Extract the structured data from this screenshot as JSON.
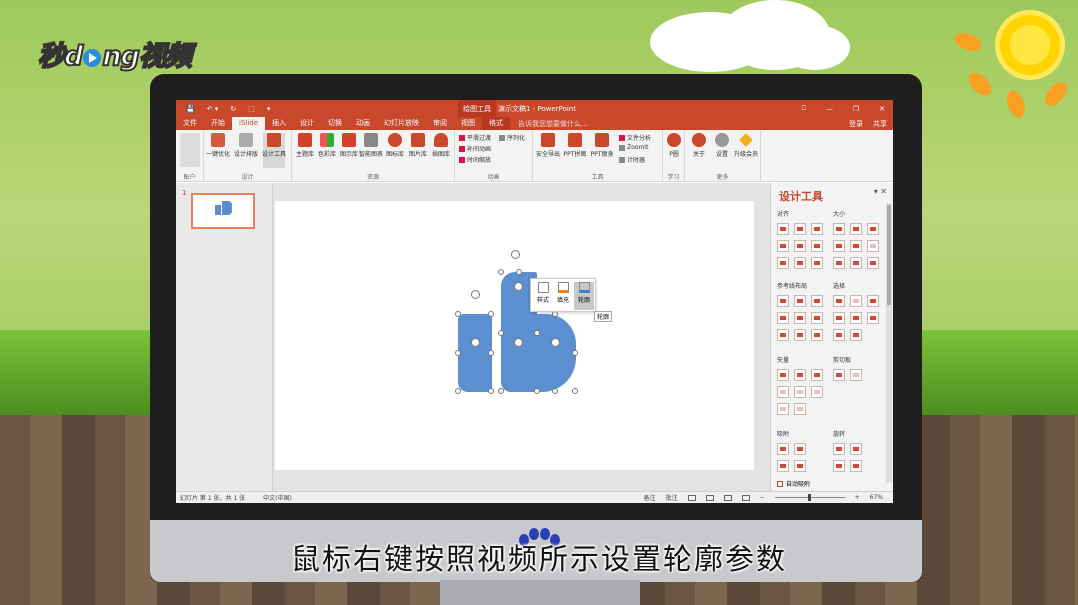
{
  "brand": {
    "text_before": "秒d",
    "text_after": "ng视频"
  },
  "window": {
    "quick_access": [
      "💾",
      "↶ ▾",
      "↻",
      "⬚",
      "▾"
    ],
    "context_group": "绘图工具",
    "doc_title": "演示文稿1 - PowerPoint",
    "controls": [
      "⎕",
      "—",
      "❐",
      "✕"
    ]
  },
  "tabs": {
    "items": [
      "文件",
      "开始",
      "iSlide",
      "插入",
      "设计",
      "切换",
      "动画",
      "幻灯片放映",
      "审阅",
      "视图",
      "格式"
    ],
    "tell_me": "告诉我您想要做什么...",
    "login": "登录",
    "share": "共享"
  },
  "ribbon": {
    "groups": [
      "账户",
      "设计",
      "资源",
      "动画",
      "工具",
      "学习",
      "更多"
    ],
    "buttons": [
      "一键优化",
      "设计排版",
      "设计工具",
      "主题库",
      "色彩库",
      "图示库",
      "智能图表",
      "图标库",
      "图片库",
      "插图库",
      "安全导出",
      "PPT拼图",
      "PPT瘦身",
      "P圈",
      "关于",
      "设置",
      "升级会员"
    ],
    "anim_items": [
      "平滑过渡",
      "序列化",
      "补间动画",
      "时间缩放"
    ],
    "tool_items": [
      "文件分析",
      "ZoomIt",
      "计时器"
    ],
    "dropdown": "▾"
  },
  "thumbs": {
    "slide_number": "1"
  },
  "minibar": {
    "style": "样式",
    "fill": "填充",
    "outline": "轮廓",
    "tooltip": "轮廓"
  },
  "pane": {
    "title": "设计工具",
    "controls": "▾ ✕",
    "sections": [
      "对齐",
      "大小",
      "参考线布局",
      "选择",
      "矢量",
      "剪切板",
      "吸附",
      "旋转"
    ],
    "auto_label": "自动吸附"
  },
  "status": {
    "slide_info": "幻灯片 第 1 张，共 1 张",
    "language": "中文(中国)",
    "notes": "备注",
    "comments": "批注",
    "zoom": "67%",
    "zoom_minus": "−",
    "zoom_plus": "+"
  },
  "caption": "鼠标右键按照视频所示设置轮廓参数",
  "colors": {
    "accent": "#c9472b",
    "shape": "#5b8fd0"
  }
}
